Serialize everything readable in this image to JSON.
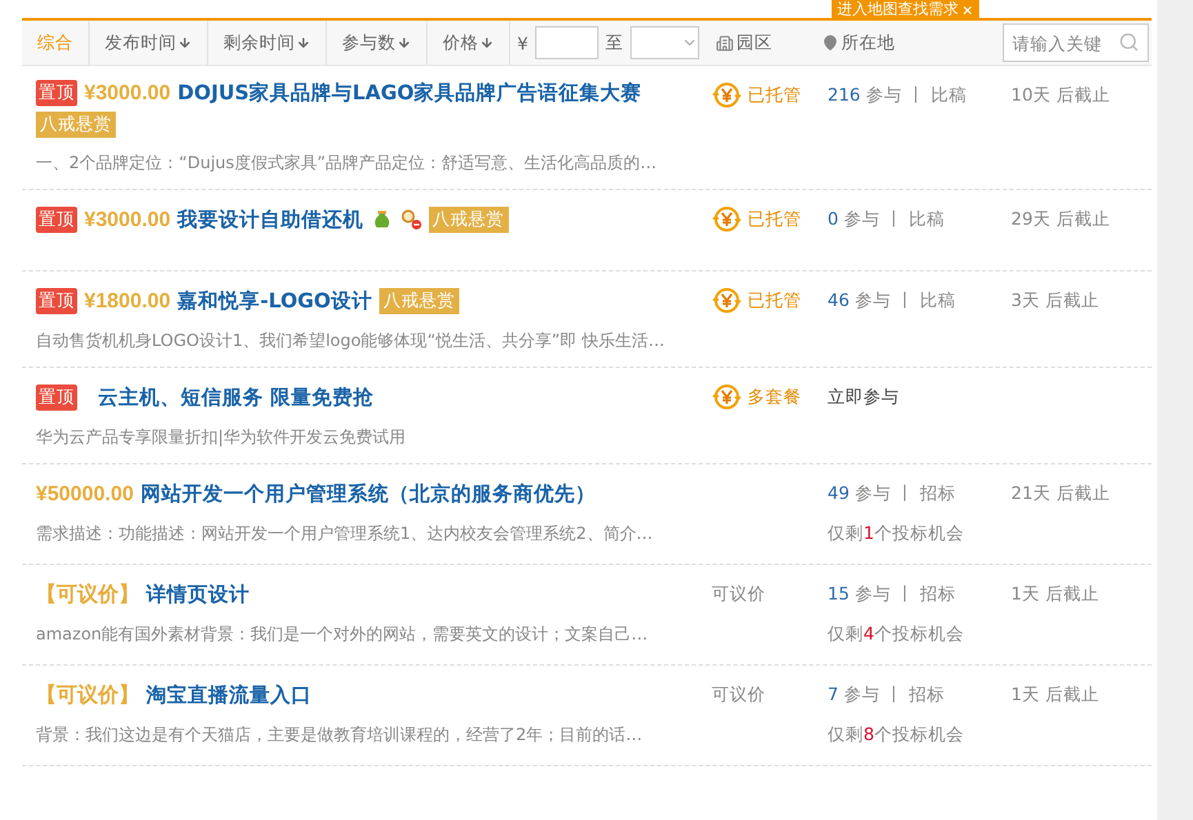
{
  "filter_bar": {
    "sorts": [
      {
        "label": "综合",
        "selected": true,
        "arrow": false
      },
      {
        "label": "发布时间",
        "selected": false,
        "arrow": true
      },
      {
        "label": "剩余时间",
        "selected": false,
        "arrow": true
      },
      {
        "label": "参与数",
        "selected": false,
        "arrow": true
      },
      {
        "label": "价格",
        "selected": false,
        "arrow": true
      }
    ],
    "price_symbol": "¥",
    "range_to": "至",
    "park": "园区",
    "location": "所在地",
    "map_tip": "进入地图查找需求",
    "search": {
      "placeholder": "请输入关键"
    }
  },
  "tasks": [
    {
      "pinned": true,
      "pin_label": "置顶",
      "price": {
        "kind": "amount",
        "text": "¥3000.00"
      },
      "title": "DOJUS家具品牌与LAGO家具品牌广告语征集大赛",
      "tag": "八戒悬赏",
      "description": "一、2个品牌定位：“Dujus度假式家具”品牌产品定位：舒适写意、生活化高品质的…",
      "status": {
        "kind": "escrow",
        "text": "已托管"
      },
      "count": "216",
      "count_text": "参与 丨 比稿",
      "deadline": "10天 后截止"
    },
    {
      "pinned": true,
      "pin_label": "置顶",
      "price": {
        "kind": "amount",
        "text": "¥3000.00"
      },
      "title": "我要设计自助借还机",
      "title_icons": [
        {
          "kind": "bag"
        },
        {
          "kind": "search"
        }
      ],
      "tag": "八戒悬赏",
      "status": {
        "kind": "escrow",
        "text": "已托管"
      },
      "count": "0",
      "count_text": "参与 丨 比稿",
      "deadline": "29天 后截止"
    },
    {
      "pinned": true,
      "pin_label": "置顶",
      "price": {
        "kind": "amount",
        "text": "¥1800.00"
      },
      "title": "嘉和悦享-LOGO设计",
      "tag": "八戒悬赏",
      "description": "自动售货机机身LOGO设计1、我们希望logo能够体现“悦生活、共分享”即 快乐生活…",
      "status": {
        "kind": "escrow",
        "text": "已托管"
      },
      "count": "46",
      "count_text": "参与 丨 比稿",
      "deadline": "3天 后截止"
    },
    {
      "pinned": true,
      "pin_label": "置顶",
      "title": "云主机、短信服务 限量免费抢",
      "description": "华为云产品专享限量折扣|华为软件开发云免费试用",
      "status": {
        "kind": "escrow",
        "text": "多套餐"
      },
      "join_link": "立即参与"
    },
    {
      "pinned": false,
      "price": {
        "kind": "amount",
        "text": "¥50000.00"
      },
      "title": "网站开发一个用户管理系统（北京的服务商优先）",
      "description": "需求描述：功能描述：网站开发一个用户管理系统1、达内校友会管理系统2、简介…",
      "count": "49",
      "count_text": "参与 丨 招标",
      "deadline": "21天 后截止",
      "chances": {
        "before": "仅剩",
        "number": "1",
        "after": "个投标机会"
      }
    },
    {
      "pinned": false,
      "price": {
        "kind": "negotiable",
        "text": "【可议价】"
      },
      "title": "详情页设计",
      "description": "amazon能有国外素材背景：我们是一个对外的网站，需要英文的设计；文案自己…",
      "status": {
        "kind": "plain",
        "text": "可议价"
      },
      "count": "15",
      "count_text": "参与 丨 招标",
      "deadline": "1天 后截止",
      "chances": {
        "before": "仅剩",
        "number": "4",
        "after": "个投标机会"
      }
    },
    {
      "pinned": false,
      "price": {
        "kind": "negotiable",
        "text": "【可议价】"
      },
      "title": "淘宝直播流量入口",
      "description": "背景：我们这边是有个天猫店，主要是做教育培训课程的，经营了2年；目前的话…",
      "status": {
        "kind": "plain",
        "text": "可议价"
      },
      "count": "7",
      "count_text": "参与 丨 招标",
      "deadline": "1天 后截止",
      "chances": {
        "before": "仅剩",
        "number": "8",
        "after": "个投标机会"
      }
    }
  ]
}
